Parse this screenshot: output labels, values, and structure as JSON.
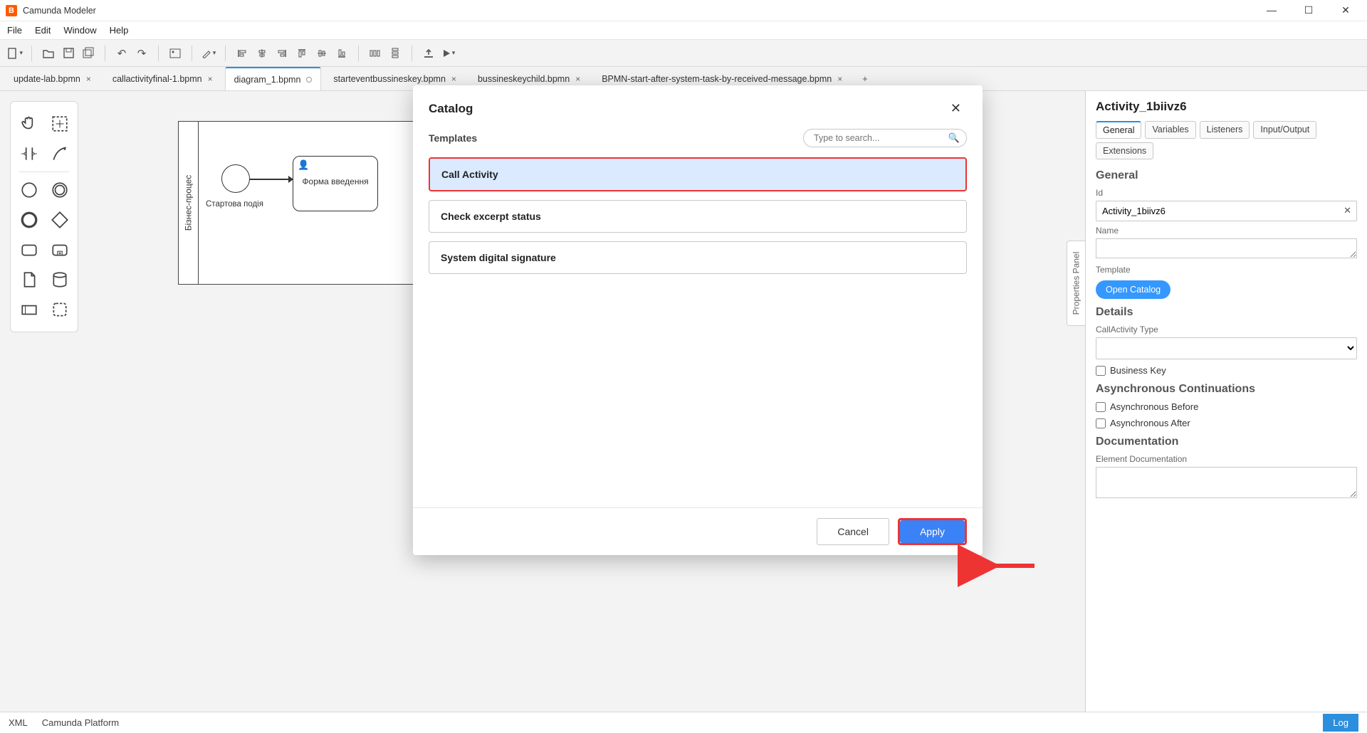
{
  "window": {
    "title": "Camunda Modeler"
  },
  "menubar": {
    "file": "File",
    "edit": "Edit",
    "window": "Window",
    "help": "Help"
  },
  "tabs": {
    "items": [
      {
        "label": "update-lab.bpmn",
        "closable": true
      },
      {
        "label": "callactivityfinal-1.bpmn",
        "closable": true
      },
      {
        "label": "diagram_1.bpmn",
        "dirty": true,
        "active": true
      },
      {
        "label": "starteventbussineskey.bpmn",
        "closable": true
      },
      {
        "label": "bussineskeychild.bpmn",
        "closable": true
      },
      {
        "label": "BPMN-start-after-system-task-by-received-message.bpmn",
        "closable": true
      }
    ],
    "add": "+"
  },
  "canvas": {
    "pool_label": "Бізнес-процес",
    "start_label": "Стартова подія",
    "task_label": "Форма введення"
  },
  "prop_tab_label": "Properties Panel",
  "properties": {
    "title": "Activity_1biivz6",
    "tabs": {
      "general": "General",
      "variables": "Variables",
      "listeners": "Listeners",
      "io": "Input/Output",
      "ext": "Extensions"
    },
    "general_section": "General",
    "id_label": "Id",
    "id_value": "Activity_1biivz6",
    "name_label": "Name",
    "name_value": "",
    "template_label": "Template",
    "open_catalog": "Open Catalog",
    "details_section": "Details",
    "callactivity_type_label": "CallActivity Type",
    "callactivity_type_value": "",
    "business_key_label": "Business Key",
    "async_section": "Asynchronous Continuations",
    "async_before_label": "Asynchronous Before",
    "async_after_label": "Asynchronous After",
    "doc_section": "Documentation",
    "doc_label": "Element Documentation",
    "doc_value": ""
  },
  "catalog": {
    "title": "Catalog",
    "templates_label": "Templates",
    "search_placeholder": "Type to search...",
    "items": [
      {
        "label": "Call Activity",
        "selected": true
      },
      {
        "label": "Check excerpt status"
      },
      {
        "label": "System digital signature"
      }
    ],
    "cancel": "Cancel",
    "apply": "Apply"
  },
  "status": {
    "xml": "XML",
    "platform": "Camunda Platform",
    "log": "Log"
  }
}
